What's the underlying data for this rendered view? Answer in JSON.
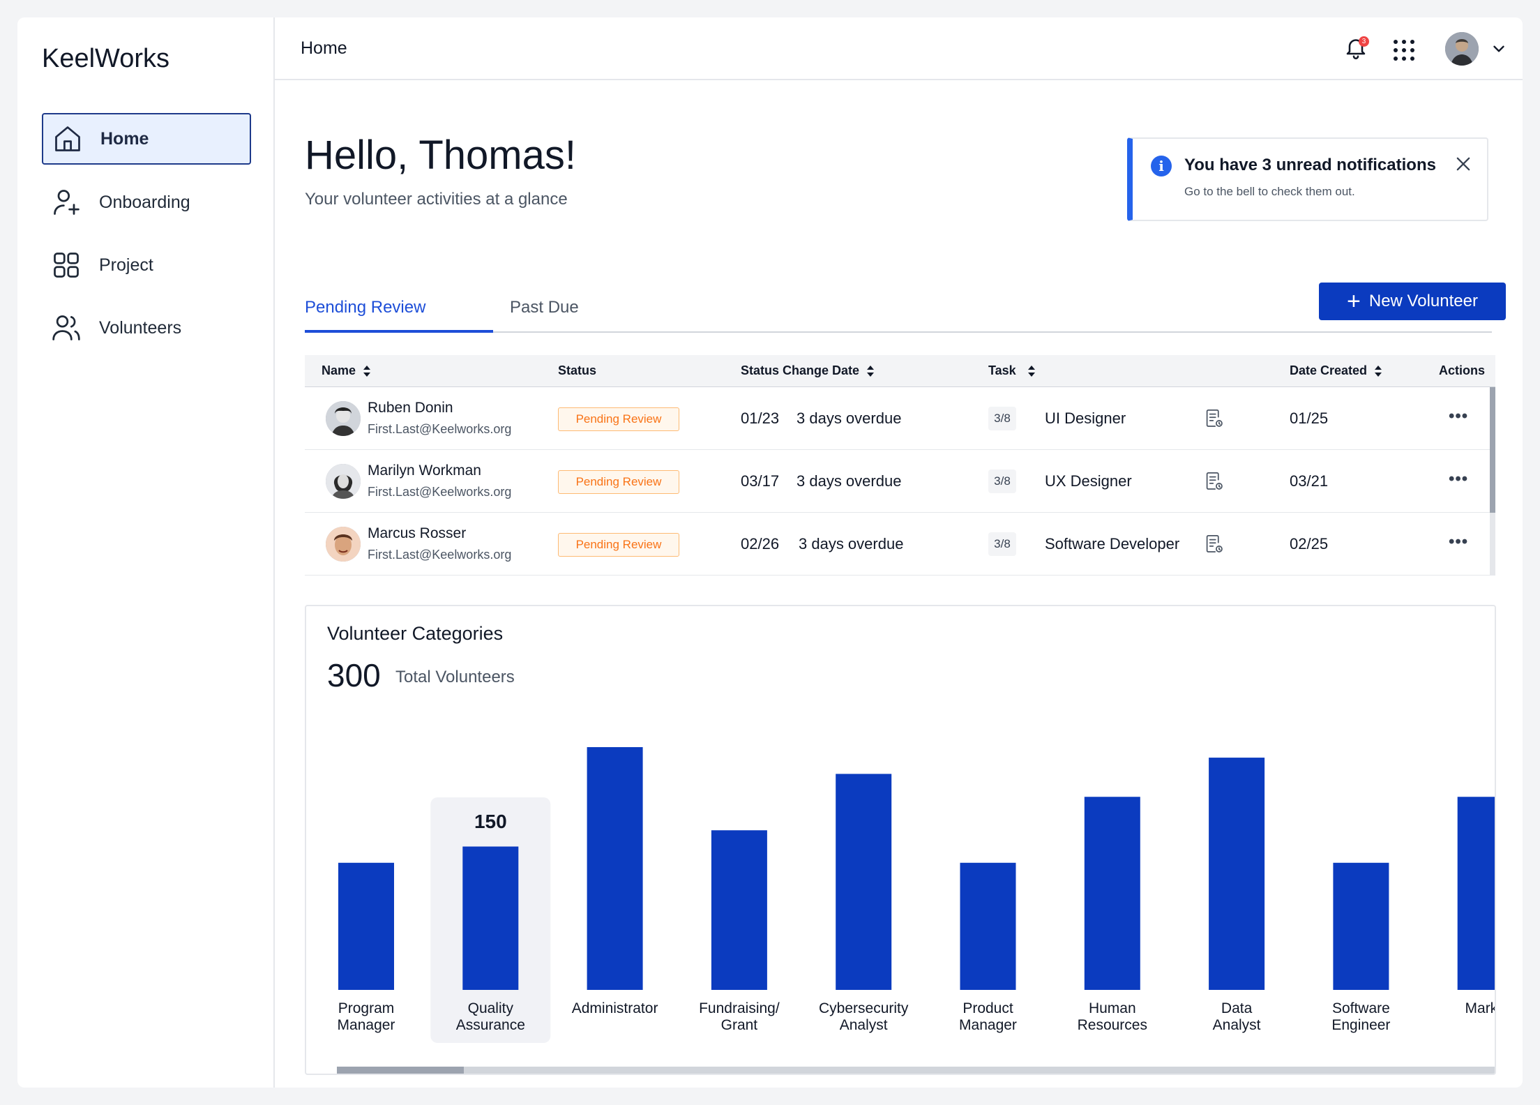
{
  "brand": "KeelWorks",
  "sidebar": {
    "items": [
      {
        "label": "Home",
        "icon": "home-icon",
        "active": true
      },
      {
        "label": "Onboarding",
        "icon": "user-plus-icon"
      },
      {
        "label": "Project",
        "icon": "grid-icon"
      },
      {
        "label": "Volunteers",
        "icon": "users-icon"
      }
    ]
  },
  "topbar": {
    "title": "Home",
    "notification_count": "3"
  },
  "greeting": {
    "title": "Hello, Thomas!",
    "subtitle": "Your volunteer activities at a glance"
  },
  "notification": {
    "title": "You have 3 unread notifications",
    "subtitle": "Go to the bell to check them out.",
    "accent": "#2563eb"
  },
  "tabs": [
    {
      "label": "Pending Review",
      "active": true
    },
    {
      "label": "Past Due",
      "active": false
    }
  ],
  "new_button": {
    "label": "New Volunteer",
    "color": "#0b3bbf"
  },
  "table": {
    "headers": {
      "name": "Name",
      "status": "Status",
      "status_change_date": "Status Change Date",
      "task": "Task",
      "date_created": "Date Created",
      "actions": "Actions"
    },
    "rows": [
      {
        "name": "Ruben Donin",
        "email": "First.Last@Keelworks.org",
        "status": "Pending Review",
        "change_date": "01/23",
        "overdue": "3 days overdue",
        "progress": "3/8",
        "task": "UI Designer",
        "created": "01/25",
        "actions": "•••"
      },
      {
        "name": "Marilyn Workman",
        "email": "First.Last@Keelworks.org",
        "status": "Pending Review",
        "change_date": "03/17",
        "overdue": "3 days overdue",
        "progress": "3/8",
        "task": "UX Designer",
        "created": "03/21",
        "actions": "•••"
      },
      {
        "name": "Marcus Rosser",
        "email": "First.Last@Keelworks.org",
        "status": "Pending Review",
        "change_date": "02/26",
        "overdue": "3 days overdue",
        "progress": "3/8",
        "task": "Software Developer",
        "created": "02/25",
        "actions": "•••"
      }
    ]
  },
  "categories_card": {
    "title": "Volunteer Categories",
    "total": "300",
    "total_label": "Total Volunteers"
  },
  "chart_data": {
    "type": "bar",
    "bar_color": "#0b3bbf",
    "highlight_index": 1,
    "highlight_label": "150",
    "categories": [
      [
        "Program",
        "Manager"
      ],
      [
        "Quality",
        "Assurance"
      ],
      [
        "Administrator"
      ],
      [
        "Fundraising/",
        "Grant"
      ],
      [
        "Cybersecurity",
        "Analyst"
      ],
      [
        "Product",
        "Manager"
      ],
      [
        "Human",
        "Resources"
      ],
      [
        "Data",
        "Analyst"
      ],
      [
        "Software",
        "Engineer"
      ],
      [
        "Marke"
      ]
    ],
    "values": [
      133,
      150,
      254,
      167,
      226,
      133,
      202,
      243,
      133,
      202
    ],
    "ylim": [
      0,
      300
    ]
  }
}
